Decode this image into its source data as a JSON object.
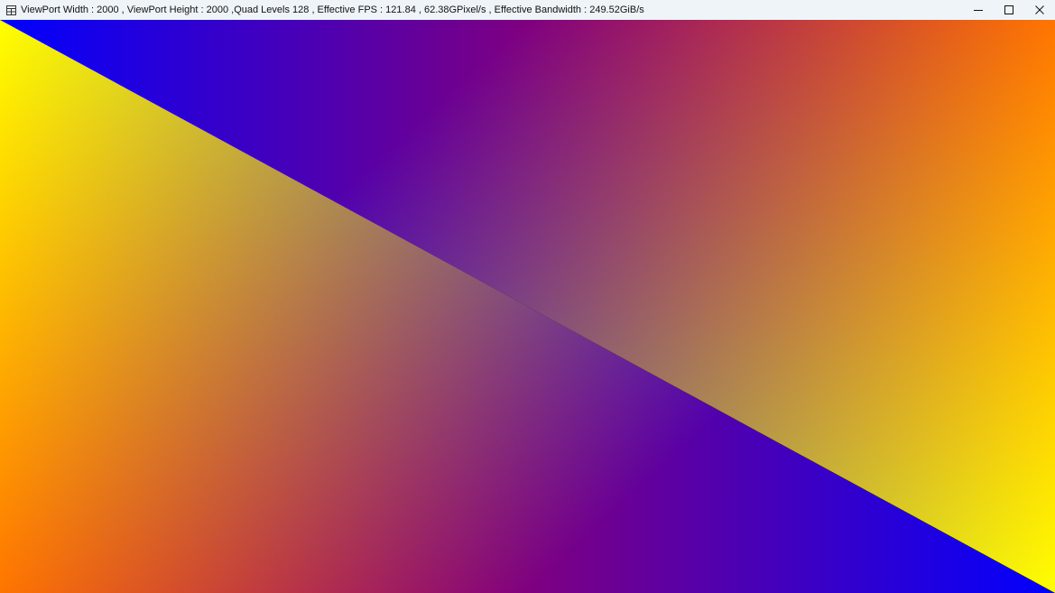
{
  "window": {
    "title": "ViewPort Width : 2000 , ViewPort Height : 2000 ,Quad Levels 128 , Effective FPS : 121.84 , 62.38GPixel/s , Effective Bandwidth : 249.52GiB/s",
    "app_icon": "app-grid-icon",
    "controls": {
      "minimize_icon": "minimize-icon",
      "maximize_icon": "maximize-icon",
      "close_icon": "close-icon"
    }
  },
  "viewport": {
    "description_colors": {
      "top_left": "#0000ff",
      "top_left_lower": "#00ff00",
      "top_right": "#ff0000",
      "bottom_left": "#ff0000",
      "bottom_right_upper": "#00ff00",
      "bottom_right": "#0000ff"
    }
  }
}
